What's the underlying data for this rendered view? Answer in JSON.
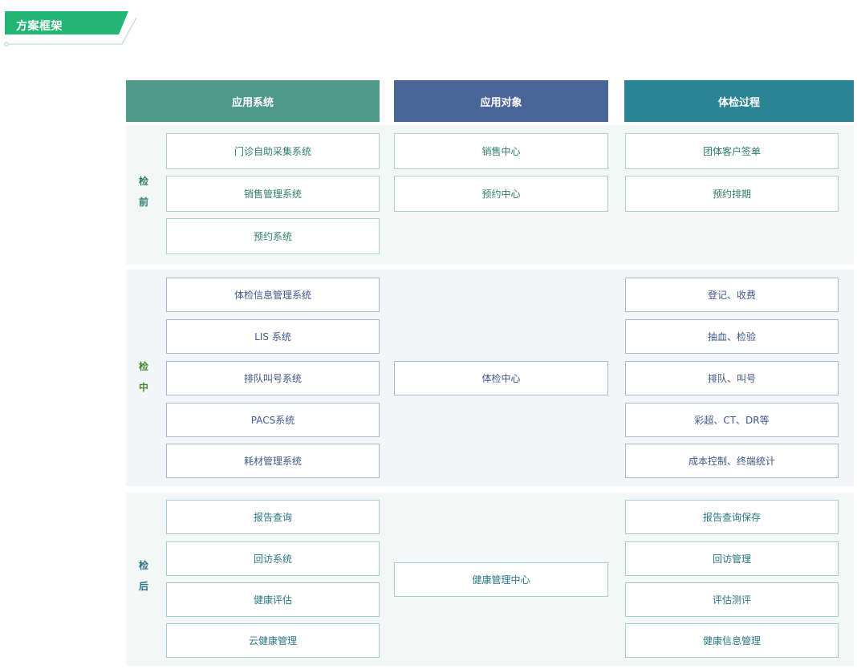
{
  "section_title": "方案框架",
  "colors": {
    "banner": "#22b573",
    "col1_header": "#4e9a87",
    "col2_header": "#4a6699",
    "col3_header": "#2a8494"
  },
  "headers": [
    "应用系统",
    "应用对象",
    "体检过程"
  ],
  "stages": {
    "pre": {
      "label1": "检",
      "label2": "前"
    },
    "mid": {
      "label1": "检",
      "label2": "中"
    },
    "post": {
      "label1": "检",
      "label2": "后"
    }
  },
  "pre": {
    "systems": [
      "门诊自助采集系统",
      "销售管理系统",
      "预约系统"
    ],
    "objects": [
      "销售中心",
      "预约中心"
    ],
    "process": [
      "团体客户签单",
      "预约排期"
    ]
  },
  "mid": {
    "systems": [
      "体检信息管理系统",
      "LIS 系统",
      "排队叫号系统",
      "PACS系统",
      "耗材管理系统"
    ],
    "objects": [
      "体检中心"
    ],
    "process": [
      "登记、收费",
      "抽血、检验",
      "排队、叫号",
      "彩超、CT、DR等",
      "成本控制、终端统计"
    ]
  },
  "post": {
    "systems": [
      "报告查询",
      "回访系统",
      "健康评估",
      "云健康管理"
    ],
    "objects": [
      "健康管理中心"
    ],
    "process": [
      "报告查询保存",
      "回访管理",
      "评估测评",
      "健康信息管理"
    ]
  }
}
